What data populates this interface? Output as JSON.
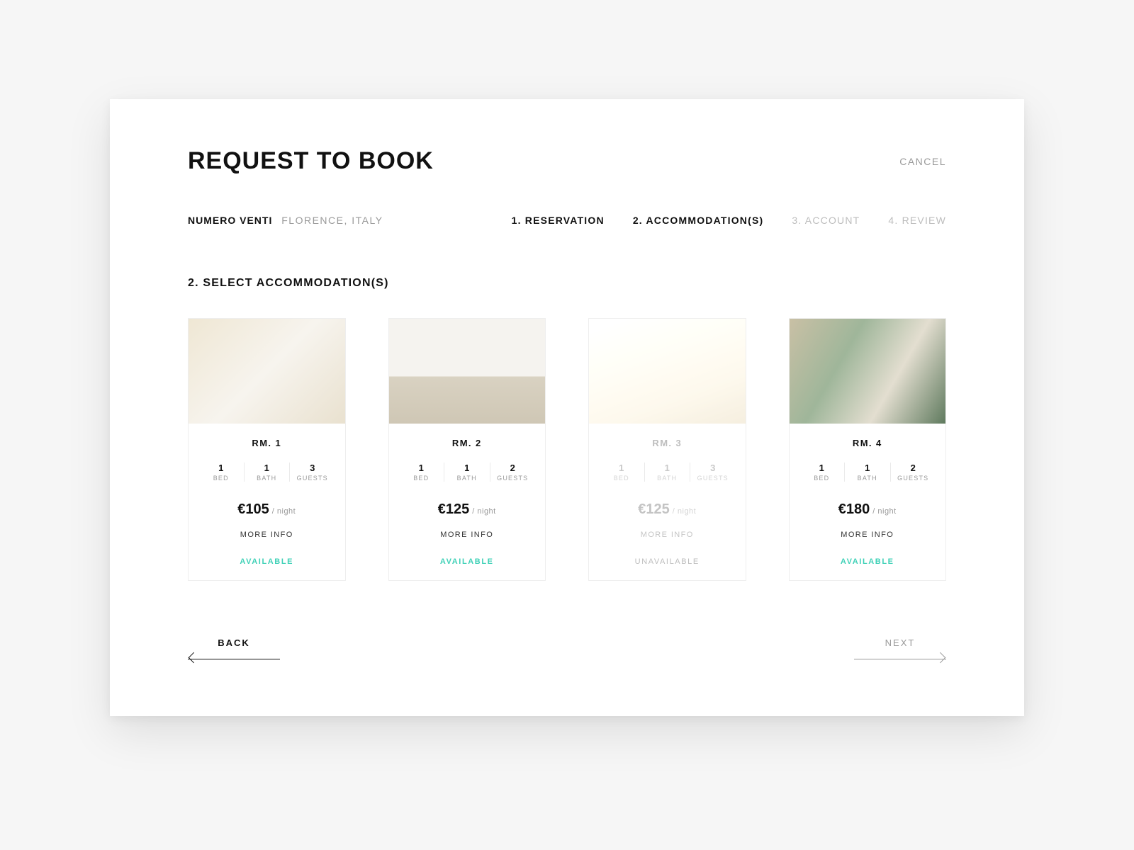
{
  "header": {
    "title": "REQUEST TO BOOK",
    "cancel": "CANCEL"
  },
  "property": {
    "name": "NUMERO VENTI",
    "location": "FLORENCE, ITALY"
  },
  "steps": [
    {
      "label": "1. RESERVATION",
      "state": "completed"
    },
    {
      "label": "2. ACCOMMODATION(S)",
      "state": "active"
    },
    {
      "label": "3. ACCOUNT",
      "state": "upcoming"
    },
    {
      "label": "4. REVIEW",
      "state": "upcoming"
    }
  ],
  "section_title": "2. SELECT ACCOMMODATION(S)",
  "labels": {
    "bed": "BED",
    "bath": "BATH",
    "guests": "GUESTS",
    "per_night": "/ night",
    "more_info": "MORE INFO",
    "available": "AVAILABLE",
    "unavailable": "UNAVAILABLE"
  },
  "rooms": [
    {
      "name": "RM. 1",
      "bed": "1",
      "bath": "1",
      "guests": "3",
      "price": "€105",
      "status": "available"
    },
    {
      "name": "RM. 2",
      "bed": "1",
      "bath": "1",
      "guests": "2",
      "price": "€125",
      "status": "available"
    },
    {
      "name": "RM. 3",
      "bed": "1",
      "bath": "1",
      "guests": "3",
      "price": "€125",
      "status": "unavailable"
    },
    {
      "name": "RM. 4",
      "bed": "1",
      "bath": "1",
      "guests": "2",
      "price": "€180",
      "status": "available"
    }
  ],
  "nav": {
    "back": "BACK",
    "next": "NEXT"
  }
}
